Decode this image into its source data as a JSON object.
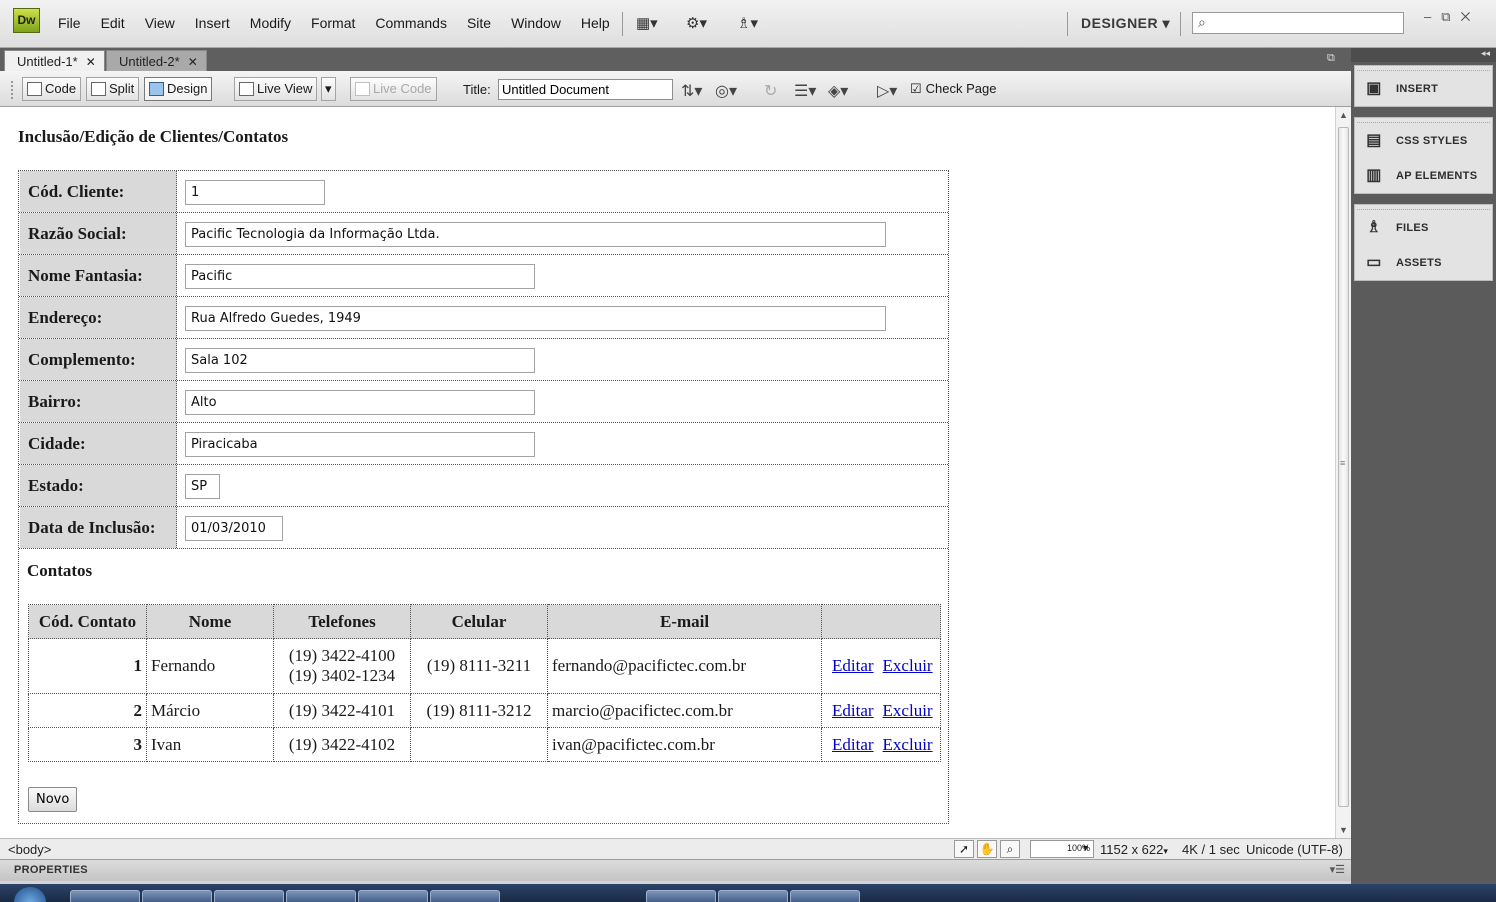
{
  "app": {
    "logo_text": "Dw",
    "menu": [
      "File",
      "Edit",
      "View",
      "Insert",
      "Modify",
      "Format",
      "Commands",
      "Site",
      "Window",
      "Help"
    ],
    "workspace": "DESIGNER"
  },
  "tabs": [
    {
      "label": "Untitled-1*",
      "active": true
    },
    {
      "label": "Untitled-2*",
      "active": false
    }
  ],
  "doc_toolbar": {
    "code_label": "Code",
    "split_label": "Split",
    "design_label": "Design",
    "live_view_label": "Live View",
    "live_code_label": "Live Code",
    "title_label": "Title:",
    "title_value": "Untitled Document",
    "check_page_label": "Check Page"
  },
  "page": {
    "heading": "Inclusão/Edição de Clientes/Contatos",
    "fields": [
      {
        "label": "Cód. Cliente:",
        "value": "1"
      },
      {
        "label": "Razão Social:",
        "value": "Pacific Tecnologia da Informação Ltda."
      },
      {
        "label": "Nome Fantasia:",
        "value": "Pacific"
      },
      {
        "label": "Endereço:",
        "value": "Rua Alfredo Guedes, 1949"
      },
      {
        "label": "Complemento:",
        "value": "Sala 102"
      },
      {
        "label": "Bairro:",
        "value": "Alto"
      },
      {
        "label": "Cidade:",
        "value": "Piracicaba"
      },
      {
        "label": "Estado:",
        "value": "SP"
      },
      {
        "label": "Data de Inclusão:",
        "value": "01/03/2010"
      }
    ],
    "contatos_label": "Contatos",
    "contacts_table": {
      "headers": [
        "Cód. Contato",
        "Nome",
        "Telefones",
        "Celular",
        "E-mail",
        ""
      ],
      "rows": [
        {
          "cod": "1",
          "nome": "Fernando",
          "tel1": "(19) 3422-4100",
          "tel2": "(19) 3402-1234",
          "celular": "(19) 8111-3211",
          "email": "fernando@pacifictec.com.br",
          "edit": "Editar",
          "delete": "Excluir"
        },
        {
          "cod": "2",
          "nome": "Márcio",
          "tel1": "(19) 3422-4101",
          "tel2": "",
          "celular": "(19) 8111-3212",
          "email": "marcio@pacifictec.com.br",
          "edit": "Editar",
          "delete": "Excluir"
        },
        {
          "cod": "3",
          "nome": "Ivan",
          "tel1": "(19) 3422-4102",
          "tel2": "",
          "celular": "",
          "email": "ivan@pacifictec.com.br",
          "edit": "Editar",
          "delete": "Excluir"
        }
      ]
    },
    "novo_button": "Novo"
  },
  "status_bar": {
    "tag_selector": "<body>",
    "zoom": "100%",
    "window_size": "1152 x 622",
    "download": "4K / 1 sec",
    "encoding": "Unicode (UTF-8)"
  },
  "properties_label": "PROPERTIES",
  "panels": [
    {
      "label": "INSERT",
      "icon": "insert-icon"
    },
    {
      "label": "CSS STYLES",
      "icon": "css-styles-icon"
    },
    {
      "label": "AP ELEMENTS",
      "icon": "ap-elements-icon"
    },
    {
      "label": "FILES",
      "icon": "files-icon"
    },
    {
      "label": "ASSETS",
      "icon": "assets-icon"
    }
  ]
}
